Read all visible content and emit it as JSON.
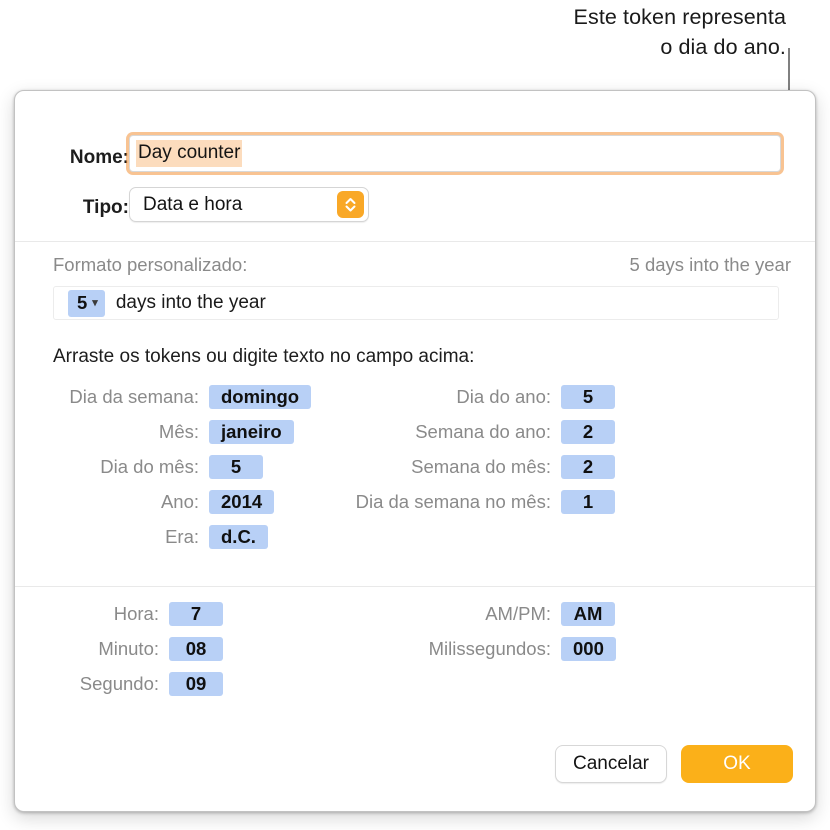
{
  "callout": {
    "line1": "Este token representa",
    "line2": "o dia do ano."
  },
  "dialog": {
    "name_row": {
      "label": "Nome:",
      "value": "Day counter"
    },
    "type_row": {
      "label": "Tipo:",
      "value": "Data e hora",
      "stepper_icon": "stepper-up-down-icon"
    },
    "format": {
      "label": "Formato personalizado:",
      "preview": "5 days into the year",
      "token": "5",
      "token_chevron_icon": "chevron-down-icon",
      "text": "days into the year"
    },
    "drag_hint": "Arraste os tokens ou digite texto no campo acima:",
    "date_tokens_left": [
      {
        "label": "Dia da semana:",
        "value": "domingo"
      },
      {
        "label": "Mês:",
        "value": "janeiro"
      },
      {
        "label": "Dia do mês:",
        "value": "5"
      },
      {
        "label": "Ano:",
        "value": "2014"
      },
      {
        "label": "Era:",
        "value": "d.C."
      }
    ],
    "date_tokens_right": [
      {
        "label": "Dia do ano:",
        "value": "5"
      },
      {
        "label": "Semana do ano:",
        "value": "2"
      },
      {
        "label": "Semana do mês:",
        "value": "2"
      },
      {
        "label": "Dia da semana no mês:",
        "value": "1"
      }
    ],
    "time_tokens_left": [
      {
        "label": "Hora:",
        "value": "7"
      },
      {
        "label": "Minuto:",
        "value": "08"
      },
      {
        "label": "Segundo:",
        "value": "09"
      }
    ],
    "time_tokens_right": [
      {
        "label": "AM/PM:",
        "value": "AM"
      },
      {
        "label": "Milissegundos:",
        "value": "000"
      }
    ],
    "buttons": {
      "cancel": "Cancelar",
      "ok": "OK"
    }
  },
  "colors": {
    "token_blue": "#b8d0f6",
    "accent_orange": "#fbb019",
    "focus_ring_orange": "#f39138",
    "selection_peach": "#fcdcbd",
    "label_gray": "#8a8a8a"
  }
}
